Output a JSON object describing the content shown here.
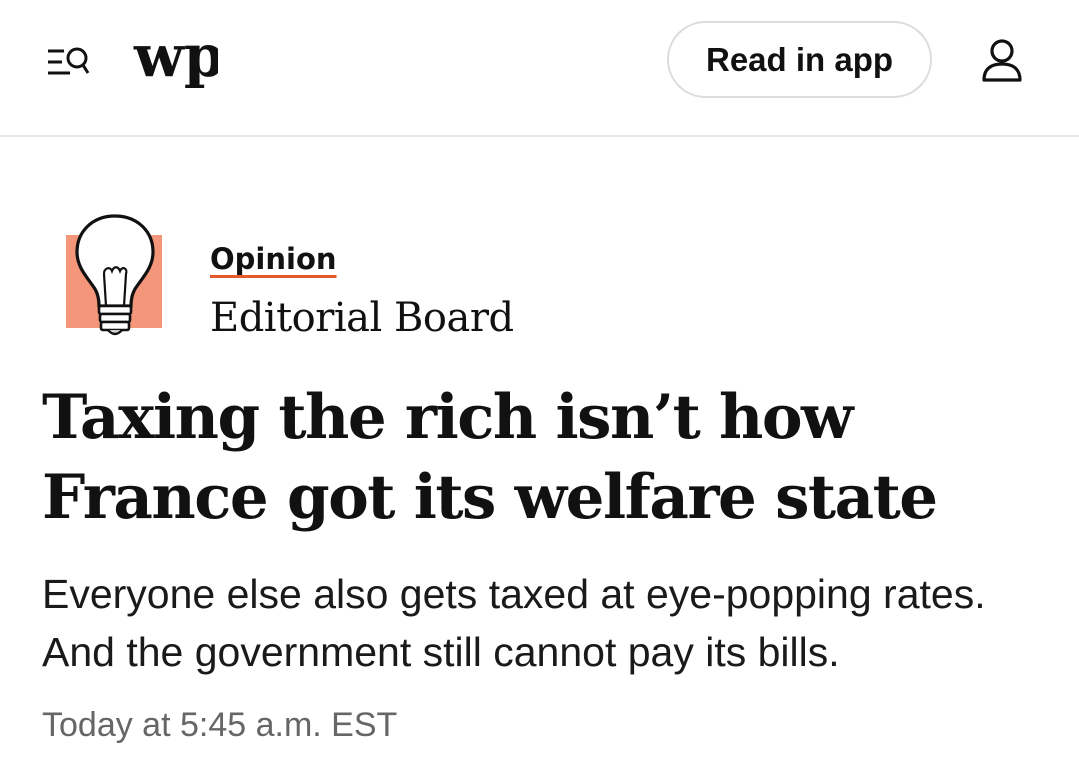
{
  "header": {
    "logo_text": "wp",
    "read_in_app_label": "Read in app",
    "icons": {
      "menu": "menu-search-icon",
      "user": "user-icon"
    }
  },
  "article": {
    "section_label": "Opinion",
    "author": "Editorial Board",
    "headline": "Taxing the rich isn’t how France got its welfare state",
    "dek": "Everyone else also gets taxed at eye-popping rates. And the government still cannot pay its bills.",
    "timestamp": "Today at 5:45 a.m. EST",
    "author_icon": "lightbulb-icon"
  },
  "colors": {
    "accent_orange": "#e55a2b",
    "bulb_background": "#f4967a",
    "divider": "#e6e6e6",
    "muted_text": "#666666"
  }
}
